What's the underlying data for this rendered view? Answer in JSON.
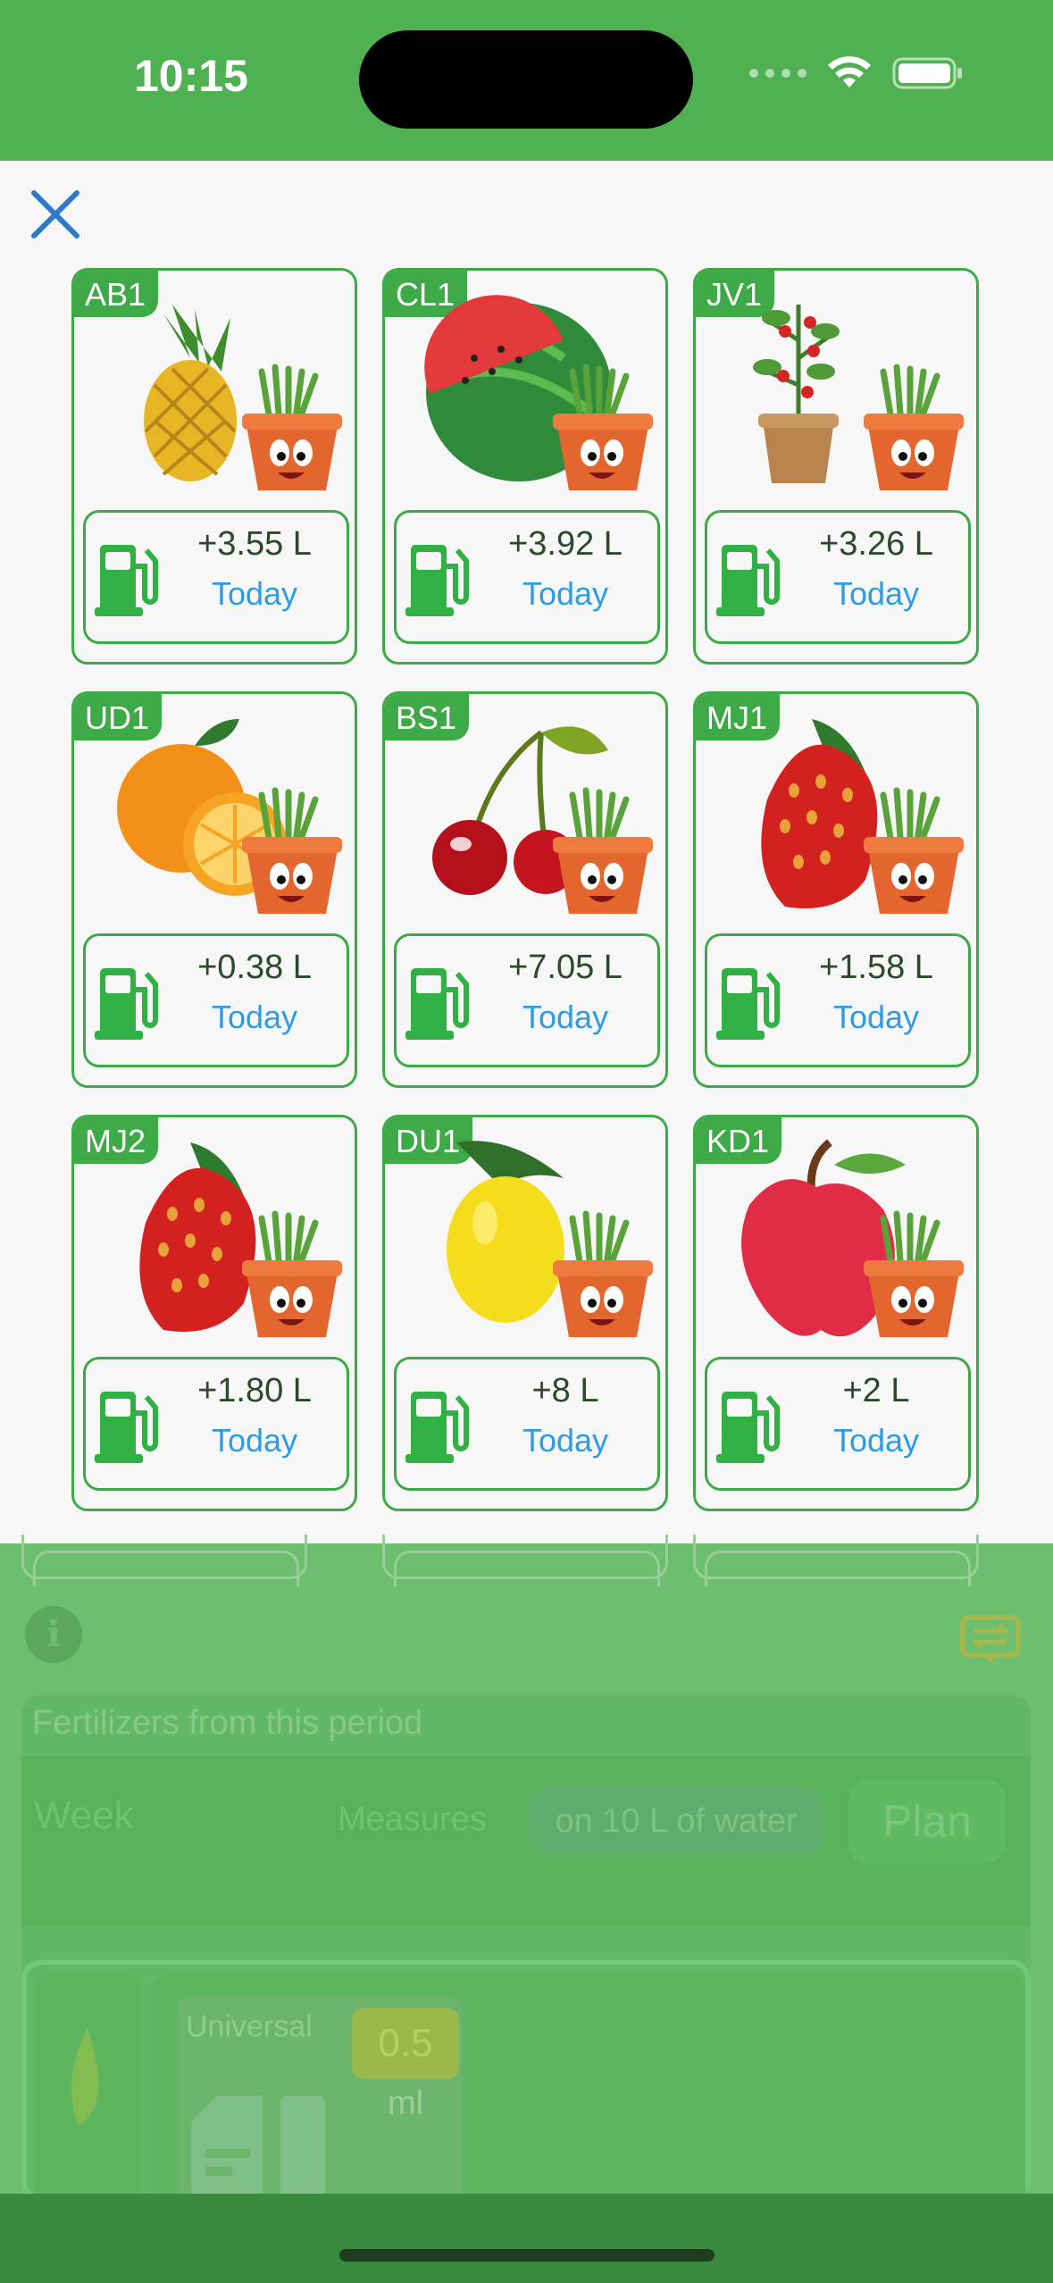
{
  "status_bar": {
    "time": "10:15"
  },
  "sheet": {
    "close_icon": "close-icon",
    "cards": [
      {
        "code": "AB1",
        "fruit": "pineapple",
        "amount": "+3.55 L",
        "when": "Today"
      },
      {
        "code": "CL1",
        "fruit": "watermelon",
        "amount": "+3.92 L",
        "when": "Today"
      },
      {
        "code": "JV1",
        "fruit": "tomato-plant",
        "amount": "+3.26 L",
        "when": "Today"
      },
      {
        "code": "UD1",
        "fruit": "orange",
        "amount": "+0.38 L",
        "when": "Today"
      },
      {
        "code": "BS1",
        "fruit": "cherry",
        "amount": "+7.05 L",
        "when": "Today"
      },
      {
        "code": "MJ1",
        "fruit": "strawberry",
        "amount": "+1.58 L",
        "when": "Today"
      },
      {
        "code": "MJ2",
        "fruit": "strawberry",
        "amount": "+1.80 L",
        "when": "Today"
      },
      {
        "code": "DU1",
        "fruit": "lemon",
        "amount": "+8 L",
        "when": "Today"
      },
      {
        "code": "KD1",
        "fruit": "apple",
        "amount": "+2 L",
        "when": "Today"
      }
    ]
  },
  "background": {
    "panel_title": "Fertilizers from this period",
    "week_label": "Week",
    "measures_label": "Measures",
    "water_chip": "on 10 L of water",
    "plan_button": "Plan",
    "fertilizer": {
      "name": "Universal",
      "quantity": "0.5",
      "unit": "ml"
    }
  },
  "colors": {
    "accent_green": "#3daa47",
    "today_blue": "#2e9be5",
    "status_green": "#4fb152"
  }
}
